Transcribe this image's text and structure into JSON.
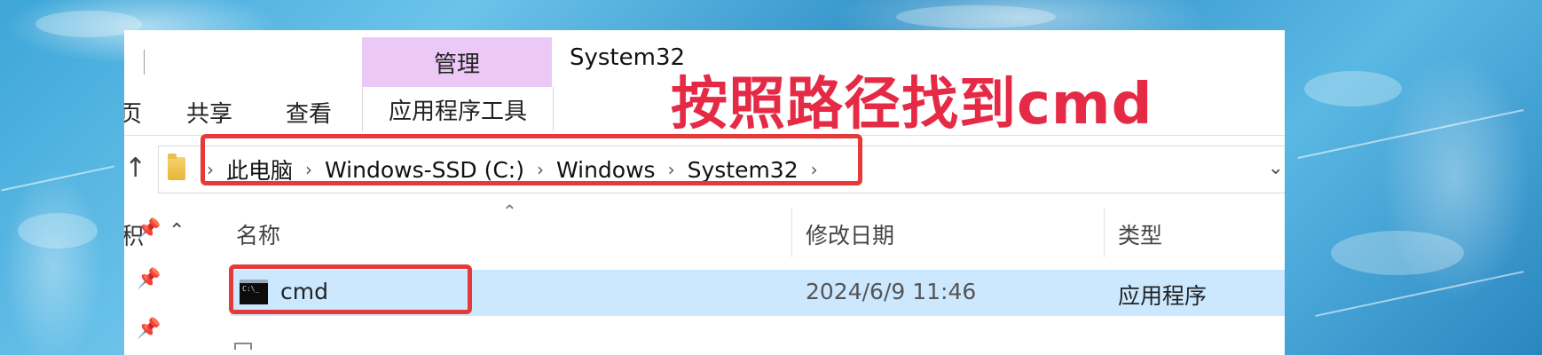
{
  "ribbon": {
    "manage_tab": "管理",
    "window_title": "System32",
    "app_tools": "应用程序工具",
    "partial_tab": "页",
    "tabs": [
      "共享",
      "查看"
    ]
  },
  "address_bar": {
    "crumbs": [
      "此电脑",
      "Windows-SSD (C:)",
      "Windows",
      "System32"
    ],
    "separator": "›"
  },
  "nav_pane": {
    "partial_label": "积"
  },
  "file_list": {
    "columns": {
      "name": "名称",
      "date": "修改日期",
      "type": "类型"
    },
    "selected": {
      "name": "cmd",
      "date": "2024/6/9 11:46",
      "type": "应用程序"
    }
  },
  "annotation": {
    "text": "按照路径找到cmd",
    "color": "#e52a45"
  },
  "highlight_color": "#e43a3a",
  "selection_color": "#cce8ff",
  "icons": [
    "up-arrow-icon",
    "folder-icon",
    "pin-icon",
    "chevron-up-icon",
    "cmd-icon",
    "chevron-down-icon"
  ]
}
